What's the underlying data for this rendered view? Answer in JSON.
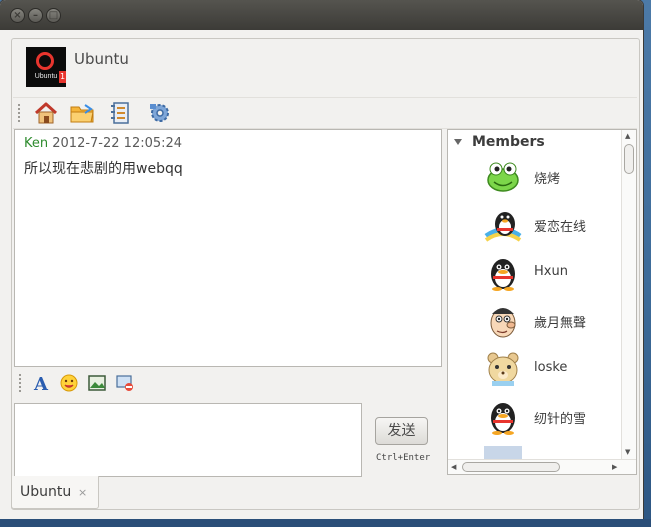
{
  "window": {
    "title_buttons": [
      "close",
      "minimize",
      "maximize"
    ]
  },
  "header": {
    "avatar_text": "Ubuntu",
    "avatar_badge": "1",
    "title": "Ubuntu"
  },
  "toolbar": {
    "icons": [
      "home-icon",
      "folder-icon",
      "contacts-icon",
      "settings-icon"
    ]
  },
  "chat": {
    "messages": [
      {
        "sender": "Ken",
        "time": "2012-7-22 12:05:24",
        "text": "所以现在悲剧的用webqq"
      }
    ]
  },
  "format_bar": {
    "icons": [
      "font-icon",
      "emoji-icon",
      "image-icon",
      "screenshot-icon"
    ]
  },
  "input": {
    "value": "",
    "placeholder": ""
  },
  "send": {
    "label": "发送",
    "hint": "Ctrl+Enter"
  },
  "members": {
    "header": "Members",
    "list": [
      {
        "name": "烧烤",
        "avatar": "green-frog-avatar"
      },
      {
        "name": "爱恋在线",
        "avatar": "penguin-rainbow-avatar"
      },
      {
        "name": "Hxun",
        "avatar": "penguin-avatar"
      },
      {
        "name": "歲月無聲",
        "avatar": "cartoon-face-avatar"
      },
      {
        "name": "loske",
        "avatar": "teddy-bear-avatar"
      },
      {
        "name": "纫针的雪",
        "avatar": "penguin-avatar"
      }
    ]
  },
  "tabs": [
    {
      "label": "Ubuntu",
      "close": "×"
    }
  ],
  "colors": {
    "titlebar": "#3c3b37",
    "window_bg": "#f2f1ef",
    "sender_name": "#2e8b2e",
    "close_button": "#86857f"
  }
}
